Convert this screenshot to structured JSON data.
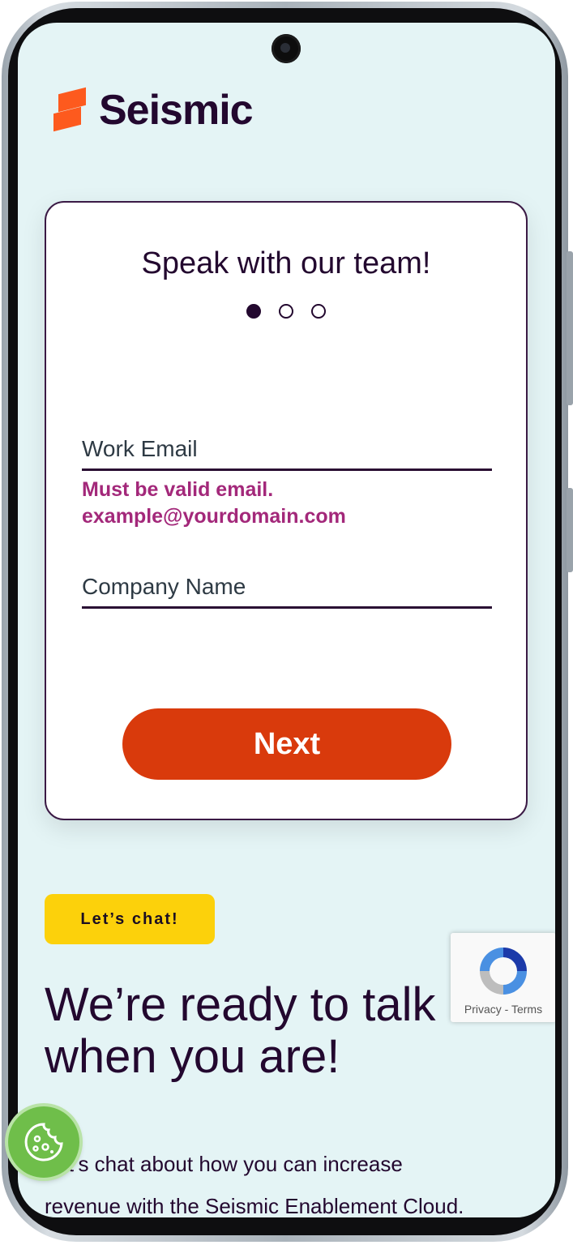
{
  "brand": {
    "name": "Seismic",
    "accent": "#fd5a1e",
    "text_color": "#23082f"
  },
  "form": {
    "title": "Speak with our team!",
    "steps": {
      "total": 3,
      "current": 1
    },
    "email_label": "Work Email",
    "email_error_line1": "Must be valid email.",
    "email_error_line2": "example@yourdomain.com",
    "company_label": "Company Name",
    "next_label": "Next",
    "button_color": "#d93a0c",
    "error_color": "#a3287a"
  },
  "chat": {
    "pill_label": "Let’s chat!",
    "headline_line1": "We’re ready to talk",
    "headline_line2": "when you are!",
    "body_line1": "Let’s chat about how you can increase",
    "body_line2": "revenue with the Seismic Enablement Cloud.",
    "pill_color": "#fcd10b"
  },
  "recaptcha": {
    "text": "Privacy - Terms"
  },
  "icons": {
    "logo": "seismic-logo-icon",
    "cookie": "cookie-icon",
    "recaptcha": "recaptcha-icon",
    "camera": "camera-icon"
  }
}
